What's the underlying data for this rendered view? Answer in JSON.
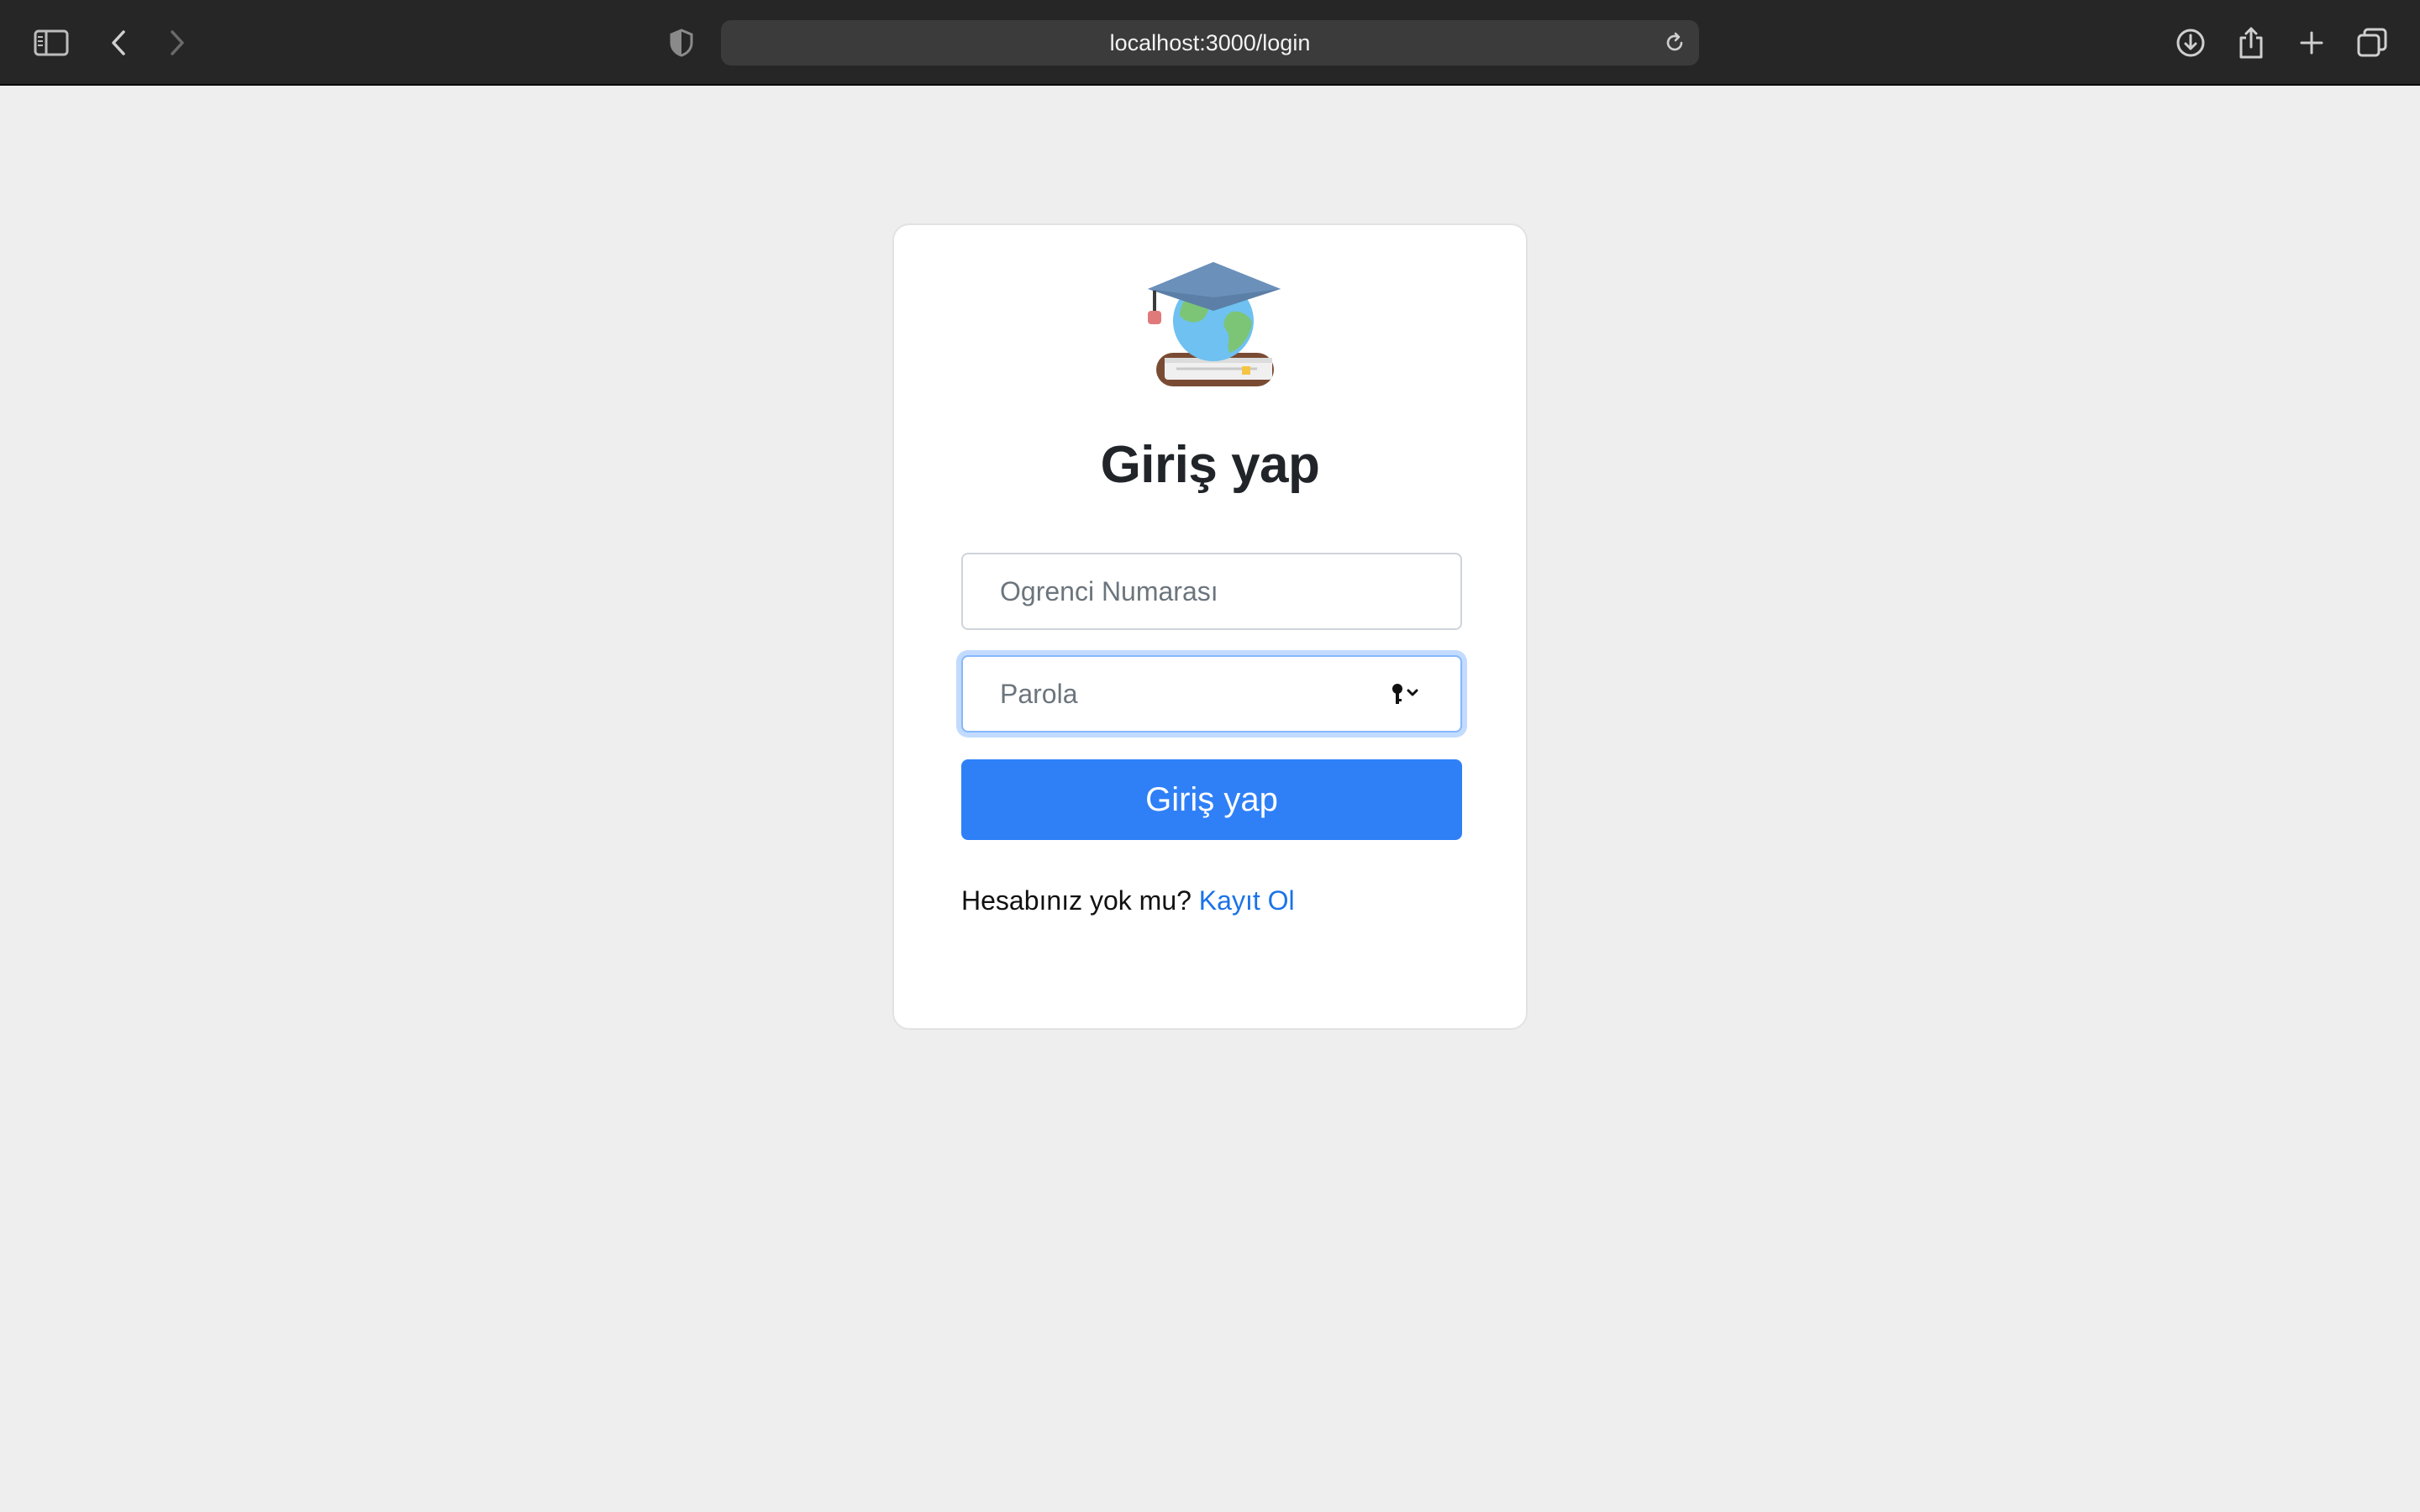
{
  "browser": {
    "url": "localhost:3000/login",
    "icons": {
      "sidebar": "sidebar-icon",
      "back": "chevron-left-icon",
      "forward": "chevron-right-icon",
      "privacy": "shield-icon",
      "reload": "reload-icon",
      "download": "download-icon",
      "share": "share-icon",
      "new_tab": "plus-icon",
      "tabs": "tabs-overview-icon"
    }
  },
  "login": {
    "logo": "graduation-cap-globe-book-icon",
    "title": "Giriş yap",
    "student_number": {
      "placeholder": "Ogrenci Numarası",
      "value": ""
    },
    "password": {
      "placeholder": "Parola",
      "value": ""
    },
    "submit_label": "Giriş yap",
    "signup_prompt": "Hesabınız yok mu?",
    "signup_link": "Kayıt Ol"
  },
  "colors": {
    "page_bg": "#eeeeee",
    "card_bg": "#ffffff",
    "primary": "#2f80f7",
    "link": "#1a73e8",
    "chrome_bg": "#262626"
  }
}
